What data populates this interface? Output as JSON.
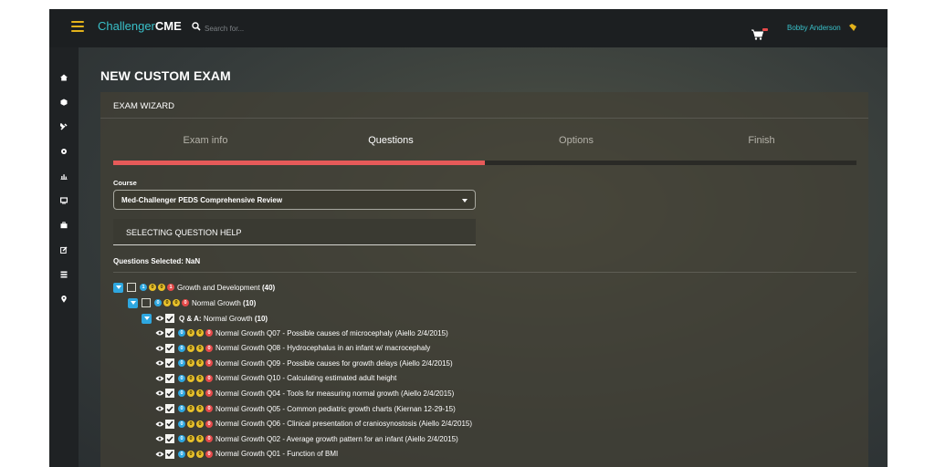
{
  "topbar": {
    "brand_main": "Challenger",
    "brand_suffix": "CME",
    "search_placeholder": "Search for...",
    "user_name": "Bobby Anderson"
  },
  "sidebar": {
    "items": [
      "home-icon",
      "box-icon",
      "tools-icon",
      "gear-icon",
      "chart-icon",
      "monitor-icon",
      "briefcase-icon",
      "edit-icon",
      "grid-icon",
      "location-pin-icon"
    ]
  },
  "page": {
    "title": "NEW CUSTOM EXAM"
  },
  "wizard": {
    "title": "EXAM WIZARD",
    "steps": [
      {
        "label": "Exam info",
        "active": false
      },
      {
        "label": "Questions",
        "active": true
      },
      {
        "label": "Options",
        "active": false
      },
      {
        "label": "Finish",
        "active": false
      }
    ],
    "progress_fraction": 0.5
  },
  "course": {
    "label": "Course",
    "selected": "Med-Challenger PEDS Comprehensive Review"
  },
  "help": {
    "title": "SELECTING QUESTION HELP"
  },
  "selection": {
    "text": "Questions Selected: NaN"
  },
  "tree": {
    "root": {
      "badges": [
        "1",
        "0",
        "0",
        "1"
      ],
      "label": "Growth and Development",
      "count": "(40)"
    },
    "section": {
      "badges": [
        "0",
        "0",
        "0",
        "0"
      ],
      "label": "Normal Growth",
      "count": "(10)"
    },
    "subsection": {
      "prefix": "Q & A:",
      "label": "Normal Growth",
      "count": "(10)"
    },
    "questions": [
      {
        "badges": [
          "0",
          "0",
          "0",
          "0"
        ],
        "label": "Normal Growth Q07 - Possible causes of microcephaly (Aiello 2/4/2015)"
      },
      {
        "badges": [
          "0",
          "0",
          "0",
          "0"
        ],
        "label": "Normal Growth Q08 - Hydrocephalus in an infant w/ macrocephaly"
      },
      {
        "badges": [
          "0",
          "0",
          "0",
          "0"
        ],
        "label": "Normal Growth Q09 - Possible causes for growth delays (Aiello 2/4/2015)"
      },
      {
        "badges": [
          "0",
          "0",
          "0",
          "0"
        ],
        "label": "Normal Growth Q10 - Calculating estimated adult height"
      },
      {
        "badges": [
          "0",
          "0",
          "0",
          "0"
        ],
        "label": "Normal Growth Q04 - Tools for measuring normal growth (Aiello 2/4/2015)"
      },
      {
        "badges": [
          "0",
          "0",
          "0",
          "0"
        ],
        "label": "Normal Growth Q05 - Common pediatric growth charts (Kiernan 12-29-15)"
      },
      {
        "badges": [
          "0",
          "0",
          "0",
          "0"
        ],
        "label": "Normal Growth Q06 - Clinical presentation of craniosynostosis (Aiello 2/4/2015)"
      },
      {
        "badges": [
          "0",
          "0",
          "0",
          "0"
        ],
        "label": "Normal Growth Q02 - Average growth pattern for an infant (Aiello 2/4/2015)"
      },
      {
        "badges": [
          "0",
          "0",
          "0",
          "0"
        ],
        "label": "Normal Growth Q01 - Function of BMI"
      }
    ]
  },
  "colors": {
    "accent_teal": "#39c0c9",
    "progress_red": "#e65a59",
    "expander_blue": "#2ea7e0",
    "badge_blue": "#2ea7e0",
    "badge_yellow": "#e8c02a",
    "badge_red": "#e44a4a",
    "menu_yellow": "#e3b21b"
  }
}
